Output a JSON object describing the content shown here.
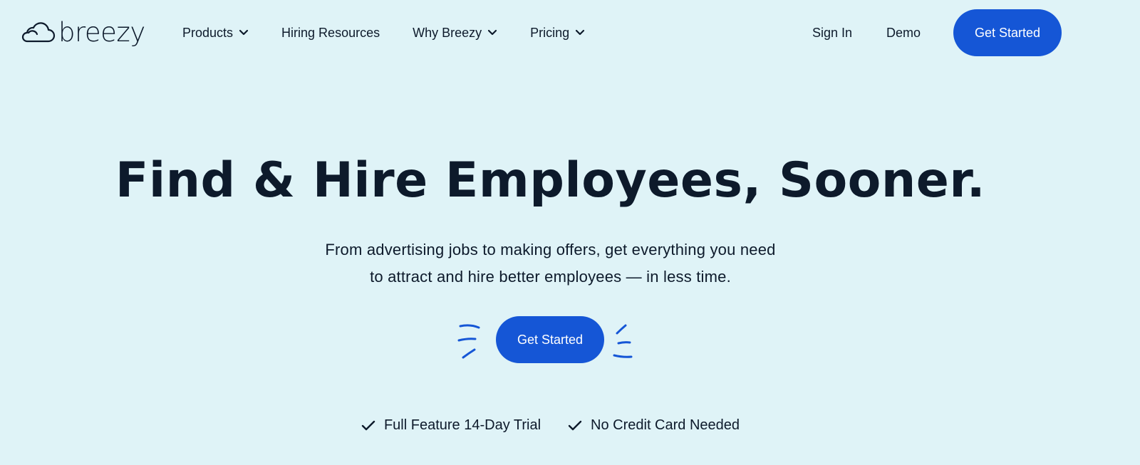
{
  "brand": {
    "name": "breezy",
    "logo_icon": "cloud-icon"
  },
  "nav": {
    "items": [
      {
        "label": "Products",
        "has_dropdown": true
      },
      {
        "label": "Hiring Resources",
        "has_dropdown": false
      },
      {
        "label": "Why Breezy",
        "has_dropdown": true
      },
      {
        "label": "Pricing",
        "has_dropdown": true
      }
    ],
    "sign_in": "Sign In",
    "demo": "Demo",
    "cta": "Get Started"
  },
  "hero": {
    "title": "Find & Hire Employees, Sooner.",
    "subtitle_line1": "From advertising jobs to making offers, get everything you need",
    "subtitle_line2": "to attract and hire better employees — in less time.",
    "cta": "Get Started",
    "features": [
      "Full Feature 14-Day Trial",
      "No Credit Card Needed"
    ]
  },
  "colors": {
    "background": "#dff3f7",
    "accent": "#1556d6",
    "text": "#0d1a2b"
  }
}
